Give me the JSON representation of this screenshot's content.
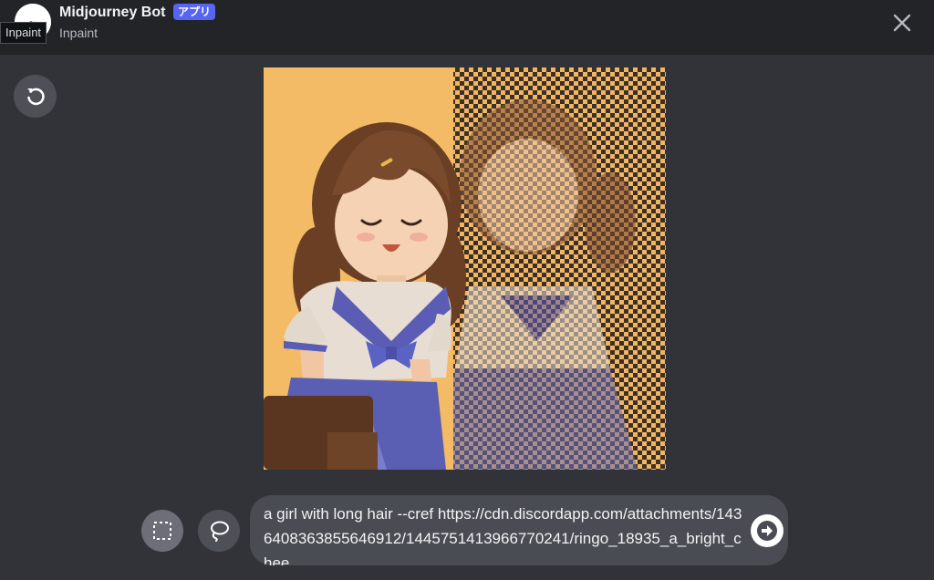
{
  "header": {
    "bot_name": "Midjourney Bot",
    "app_badge": "アプリ",
    "subtitle": "Inpaint",
    "tooltip": "Inpaint"
  },
  "icons": {
    "close": "close-icon",
    "reset": "undo-icon",
    "rect_select": "rectangle-select-icon",
    "lasso": "lasso-icon",
    "send": "send-arrow-icon"
  },
  "prompt": {
    "text": "a girl with long hair --cref https://cdn.discordapp.com/attachments/1436408363855646912/1445751413966770241/ringo_18935_a_bright_chee"
  },
  "colors": {
    "background": "#313338",
    "header": "#232428",
    "badge": "#5865f2",
    "image_background": "#f2b661"
  }
}
